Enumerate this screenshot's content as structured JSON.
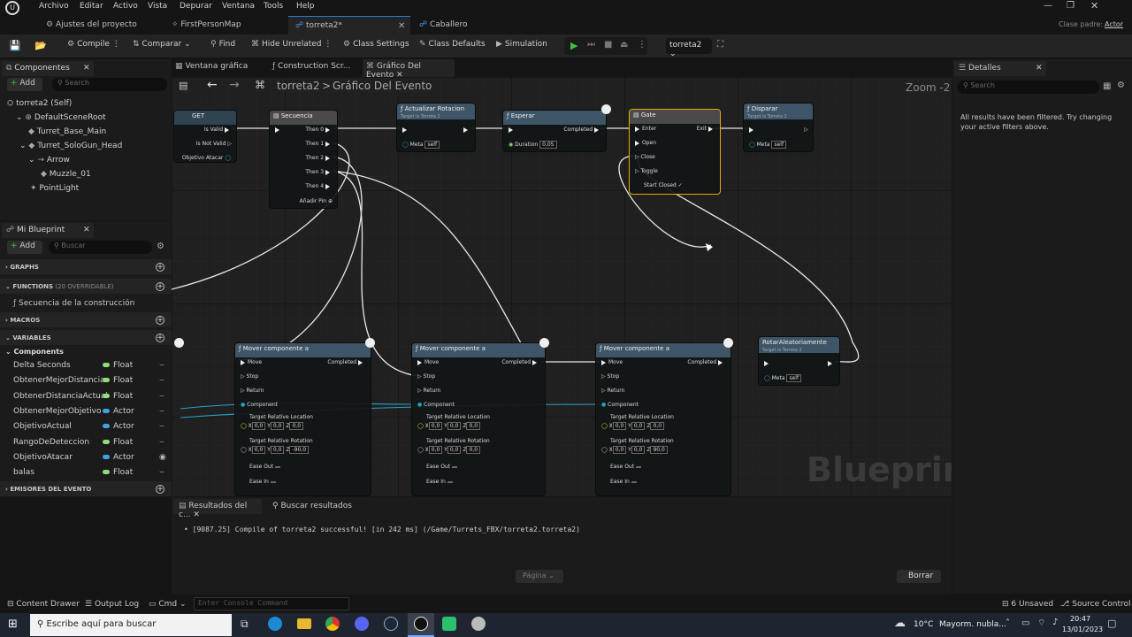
{
  "menu": [
    "Archivo",
    "Editar",
    "Activo",
    "Vista",
    "Depurar",
    "Ventana",
    "Tools",
    "Help"
  ],
  "tabs": [
    {
      "label": "Ajustes del proyecto"
    },
    {
      "label": "FirstPersonMap"
    },
    {
      "label": "torreta2*"
    },
    {
      "label": "Caballero"
    }
  ],
  "parent": {
    "label": "Clase padre:",
    "value": "Actor"
  },
  "toolbar": {
    "compile": "Compile",
    "compare": "Comparar",
    "find": "Find",
    "hide": "Hide Unrelated",
    "class_settings": "Class Settings",
    "class_defaults": "Class Defaults",
    "simulation": "Simulation",
    "debug_target": "torreta2"
  },
  "components": {
    "title": "Componentes",
    "add": "Add",
    "search": "Search",
    "items": [
      "torreta2 (Self)",
      "DefaultSceneRoot",
      "Turret_Base_Main",
      "Turret_SoloGun_Head",
      "Arrow",
      "Muzzle_01",
      "PointLight"
    ]
  },
  "blueprint": {
    "title": "Mi Blueprint",
    "add": "Add",
    "search": "Buscar",
    "graphs": "GRAPHS",
    "functions": "FUNCTIONS",
    "overridable": "(20 OVERRIDABLE)",
    "construction": "Secuencia de la construcción",
    "macros": "MACROS",
    "variables": "VARIABLES",
    "components_cat": "Components",
    "dispatchers": "EMISORES DEL EVENTO",
    "vars": [
      {
        "name": "Delta Seconds",
        "type": "Float",
        "color": "#8fe07a"
      },
      {
        "name": "ObtenerMejorDistancia",
        "type": "Float",
        "color": "#8fe07a"
      },
      {
        "name": "ObtenerDistanciaActual",
        "type": "Float",
        "color": "#8fe07a"
      },
      {
        "name": "ObtenerMejorObjetivo",
        "type": "Actor",
        "color": "#3fa3e0"
      },
      {
        "name": "ObjetivoActual",
        "type": "Actor",
        "color": "#3fa3e0"
      },
      {
        "name": "RangoDeDeteccion",
        "type": "Float",
        "color": "#8fe07a"
      },
      {
        "name": "ObjetivoAtacar",
        "type": "Actor",
        "color": "#3fa3e0"
      },
      {
        "name": "balas",
        "type": "Float",
        "color": "#8fe07a"
      }
    ]
  },
  "graph_tabs": [
    "Ventana gráfica",
    "Construction Scr...",
    "Gráfico Del Evento"
  ],
  "breadcrumb": {
    "asset": "torreta2",
    "sep": ">",
    "graph": "Gráfico Del Evento"
  },
  "zoom": "Zoom -2",
  "watermark": "Blueprint",
  "nodes": {
    "get": {
      "title": "GET",
      "is_valid": "Is Valid",
      "is_not_valid": "Is Not Valid",
      "input": "Objetivo Atacar"
    },
    "seq": {
      "title": "Secuencia",
      "pins": [
        "Then 0",
        "Then 1",
        "Then 2",
        "Then 3",
        "Then 4"
      ],
      "add": "Añadir Pin"
    },
    "rot": {
      "title": "Actualizar Rotacion",
      "sub": "Target is Torreta 2",
      "meta": "Meta",
      "self": "self"
    },
    "delay": {
      "title": "Esperar",
      "completed": "Completed",
      "duration": "Duration",
      "value": "0,05"
    },
    "gate": {
      "title": "Gate",
      "enter": "Enter",
      "exit": "Exit",
      "open": "Open",
      "close": "Close",
      "toggle": "Toggle",
      "start": "Start Closed"
    },
    "fire": {
      "title": "Disparar",
      "sub": "Target is Torreta 2",
      "meta": "Meta",
      "self": "self"
    },
    "move": {
      "title": "Mover componente a",
      "move": "Move",
      "completed": "Completed",
      "stop": "Stop",
      "return": "Return",
      "component": "Component",
      "loc": "Target Relative Location",
      "rotl": "Target Relative Rotation",
      "ease_out": "Ease Out",
      "ease_in": "Ease In",
      "x": "X",
      "y": "Y",
      "z": "Z",
      "zero": "0,0",
      "z1": "-90,0",
      "z3": "90,0"
    },
    "rand": {
      "title": "RotarAleatoriamente",
      "sub": "Target is Torreta 2",
      "meta": "Meta",
      "self": "self"
    }
  },
  "details": {
    "title": "Detalles",
    "search": "Search",
    "message": "All results have been filtered. Try changing your active filters above."
  },
  "results": {
    "tab1": "Resultados del c...",
    "tab2": "Buscar resultados",
    "log": "[9087.25] Compile of torreta2 successful! [in 242 ms] (/Game/Turrets_FBX/torreta2.torreta2)",
    "page": "Página",
    "clear": "Borrar"
  },
  "status": {
    "drawer": "Content Drawer",
    "output": "Output Log",
    "cmd": "Cmd",
    "console": "Enter Console Command",
    "unsaved": "6 Unsaved",
    "source": "Source Control"
  },
  "taskbar": {
    "search": "Escribe aquí para buscar",
    "temp": "10°C",
    "weather": "Mayorm. nubla...",
    "time": "20:47",
    "date": "13/01/2023"
  }
}
